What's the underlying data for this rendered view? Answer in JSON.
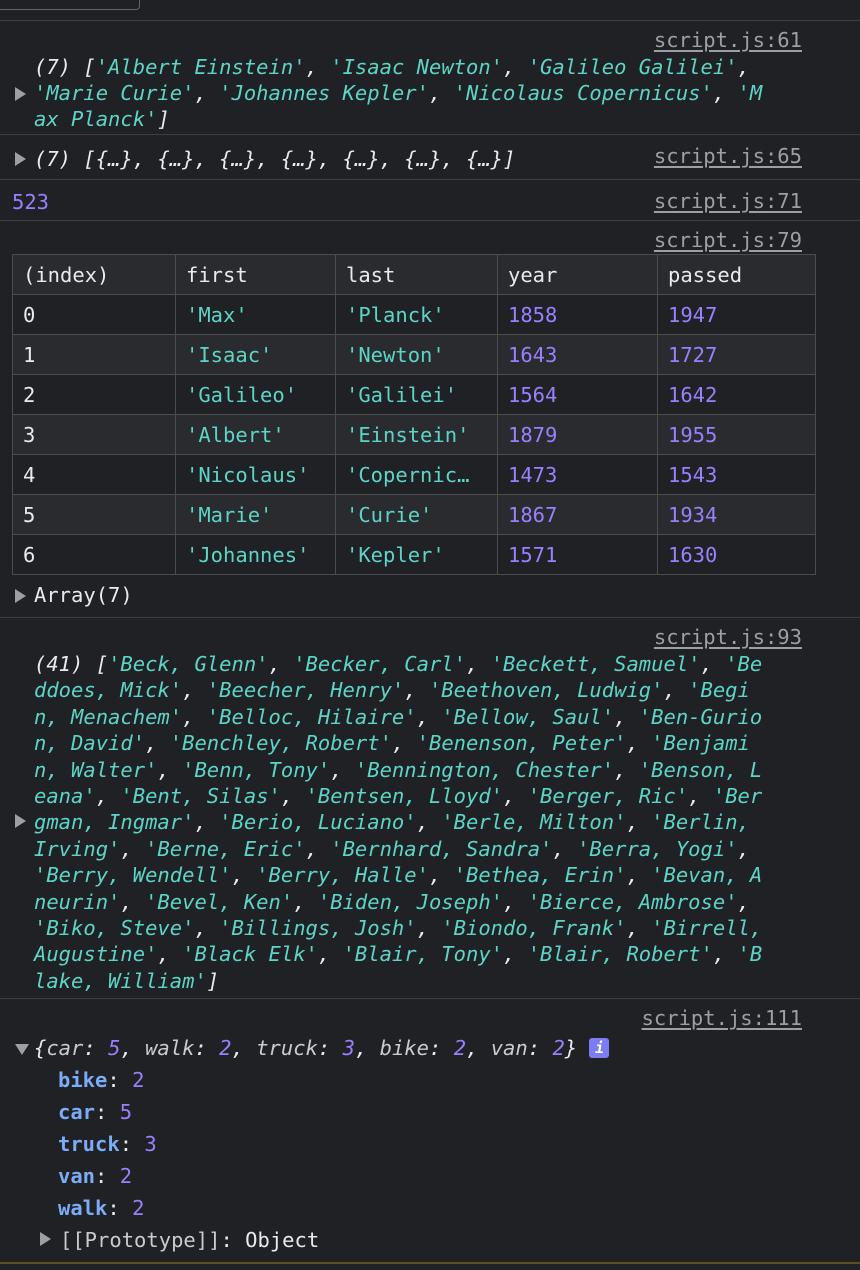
{
  "entry1": {
    "source": "script.js:61",
    "lines": [
      [
        [
          "plain",
          "(7) "
        ],
        [
          "plain",
          "["
        ],
        [
          "str",
          "'Albert Einstein'"
        ],
        [
          "plain",
          ", "
        ],
        [
          "str",
          "'Isaac Newton'"
        ],
        [
          "plain",
          ", "
        ],
        [
          "str",
          "'Galileo Galilei'"
        ],
        [
          "plain",
          ","
        ]
      ],
      [
        [
          "str",
          "'Marie Curie'"
        ],
        [
          "plain",
          ", "
        ],
        [
          "str",
          "'Johannes Kepler'"
        ],
        [
          "plain",
          ", "
        ],
        [
          "str",
          "'Nicolaus Copernicus'"
        ],
        [
          "plain",
          ", "
        ],
        [
          "str",
          "'M"
        ]
      ],
      [
        [
          "str",
          "ax Planck'"
        ],
        [
          "plain",
          "]"
        ]
      ]
    ]
  },
  "entry2": {
    "source": "script.js:65",
    "text": "(7) [{…}, {…}, {…}, {…}, {…}, {…}, {…}]"
  },
  "entry3": {
    "source": "script.js:71",
    "value": "523"
  },
  "entry4": {
    "source": "script.js:79",
    "headers": [
      "(index)",
      "first",
      "last",
      "year",
      "passed"
    ],
    "rows": [
      [
        "0",
        "'Max'",
        "'Planck'",
        "1858",
        "1947"
      ],
      [
        "1",
        "'Isaac'",
        "'Newton'",
        "1643",
        "1727"
      ],
      [
        "2",
        "'Galileo'",
        "'Galilei'",
        "1564",
        "1642"
      ],
      [
        "3",
        "'Albert'",
        "'Einstein'",
        "1879",
        "1955"
      ],
      [
        "4",
        "'Nicolaus'",
        "'Copernic…",
        "1473",
        "1543"
      ],
      [
        "5",
        "'Marie'",
        "'Curie'",
        "1867",
        "1934"
      ],
      [
        "6",
        "'Johannes'",
        "'Kepler'",
        "1571",
        "1630"
      ]
    ],
    "array_label": "Array(7)"
  },
  "entry5": {
    "source": "script.js:93",
    "lines": [
      "(41) ['Beck, Glenn', 'Becker, Carl', 'Beckett, Samuel', 'Be",
      "ddoes, Mick', 'Beecher, Henry', 'Beethoven, Ludwig', 'Begi",
      "n, Menachem', 'Belloc, Hilaire', 'Bellow, Saul', 'Ben-Gurio",
      "n, David', 'Benchley, Robert', 'Benenson, Peter', 'Benjami",
      "n, Walter', 'Benn, Tony', 'Bennington, Chester', 'Benson, L",
      "eana', 'Bent, Silas', 'Bentsen, Lloyd', 'Berger, Ric', 'Ber",
      "gman, Ingmar', 'Berio, Luciano', 'Berle, Milton', 'Berlin,",
      "Irving', 'Berne, Eric', 'Bernhard, Sandra', 'Berra, Yogi',",
      "'Berry, Wendell', 'Berry, Halle', 'Bethea, Erin', 'Bevan, A",
      "neurin', 'Bevel, Ken', 'Biden, Joseph', 'Bierce, Ambrose',",
      "'Biko, Steve', 'Billings, Josh', 'Biondo, Frank', 'Birrell,",
      "Augustine', 'Black Elk', 'Blair, Tony', 'Blair, Robert', 'B",
      "lake, William']"
    ]
  },
  "entry6": {
    "source": "script.js:111",
    "summary": [
      [
        "plain",
        "{"
      ],
      [
        "dim",
        "car"
      ],
      [
        "plain",
        ": "
      ],
      [
        "num",
        "5"
      ],
      [
        "plain",
        ", "
      ],
      [
        "dim",
        "walk"
      ],
      [
        "plain",
        ": "
      ],
      [
        "num",
        "2"
      ],
      [
        "plain",
        ", "
      ],
      [
        "dim",
        "truck"
      ],
      [
        "plain",
        ": "
      ],
      [
        "num",
        "3"
      ],
      [
        "plain",
        ", "
      ],
      [
        "dim",
        "bike"
      ],
      [
        "plain",
        ": "
      ],
      [
        "num",
        "2"
      ],
      [
        "plain",
        ", "
      ],
      [
        "dim",
        "van"
      ],
      [
        "plain",
        ": "
      ],
      [
        "num",
        "2"
      ],
      [
        "plain",
        "}"
      ]
    ],
    "badge": "i",
    "props": [
      {
        "key": "bike",
        "value": "2"
      },
      {
        "key": "car",
        "value": "5"
      },
      {
        "key": "truck",
        "value": "3"
      },
      {
        "key": "van",
        "value": "2"
      },
      {
        "key": "walk",
        "value": "2"
      }
    ],
    "prototype_label": "[[Prototype]]",
    "prototype_value": "Object"
  }
}
